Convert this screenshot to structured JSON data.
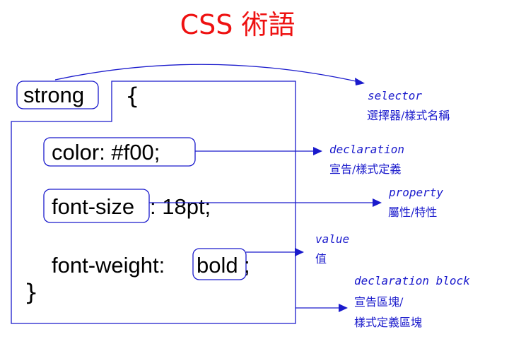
{
  "title": "CSS 術語",
  "code": {
    "selector": "strong",
    "open_brace": "{",
    "close_brace": "}",
    "line1": "color: #f00;",
    "line2_property": "font-size",
    "line2_rest": ": 18pt;",
    "line3_property": "font-weight:",
    "line3_value": "bold",
    "line3_end": ";"
  },
  "labels": {
    "selector_en": "selector",
    "selector_zh": "選擇器/樣式名稱",
    "declaration_en": "declaration",
    "declaration_zh": "宣告/樣式定義",
    "property_en": "property",
    "property_zh": "屬性/特性",
    "value_en": "value",
    "value_zh": "值",
    "block_en": "declaration block",
    "block_zh1": "宣告區塊/",
    "block_zh2": "樣式定義區塊"
  },
  "colors": {
    "title": "#ee1111",
    "annotation": "#1a1acc",
    "code_text": "#000000"
  }
}
